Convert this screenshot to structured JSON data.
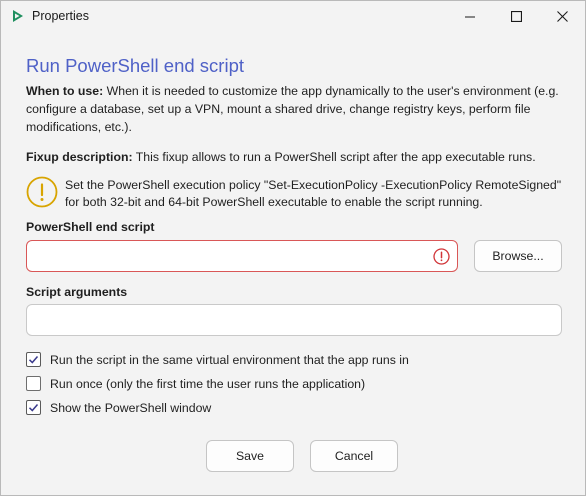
{
  "window": {
    "title": "Properties"
  },
  "dialog": {
    "heading": "Run PowerShell end script",
    "when_to_use_label": "When to use:",
    "when_to_use_text": " When it is needed to customize the app dynamically to the user's environment (e.g. configure a database, set up a VPN, mount a shared drive, change registry keys, perform file modifications, etc.).",
    "fixup_label": "Fixup description:",
    "fixup_text": " This fixup allows to run a PowerShell script after the app executable runs.",
    "warning_text": "Set the PowerShell execution policy \"Set-ExecutionPolicy -ExecutionPolicy RemoteSigned\" for both 32-bit and 64-bit PowerShell executable to enable the script running."
  },
  "fields": {
    "script_label": "PowerShell end script",
    "script_value": "",
    "args_label": "Script arguments",
    "args_value": ""
  },
  "buttons": {
    "browse": "Browse...",
    "save": "Save",
    "cancel": "Cancel"
  },
  "options": [
    {
      "label": "Run the script in the same virtual environment that the app runs in",
      "checked": true
    },
    {
      "label": "Run once (only the first time the user runs the application)",
      "checked": false
    },
    {
      "label": "Show the PowerShell window",
      "checked": true
    }
  ],
  "colors": {
    "heading": "#4f61c7",
    "error": "#d13438",
    "warning": "#d8a400",
    "app_icon": "#1f8f5f",
    "checkbox_check": "#3a3a8c"
  },
  "icons": {
    "app": "app-logo-icon",
    "minimize": "minimize-icon",
    "maximize": "maximize-icon",
    "close": "close-icon",
    "warning": "warning-icon",
    "error": "error-icon",
    "check": "checkmark-icon"
  }
}
